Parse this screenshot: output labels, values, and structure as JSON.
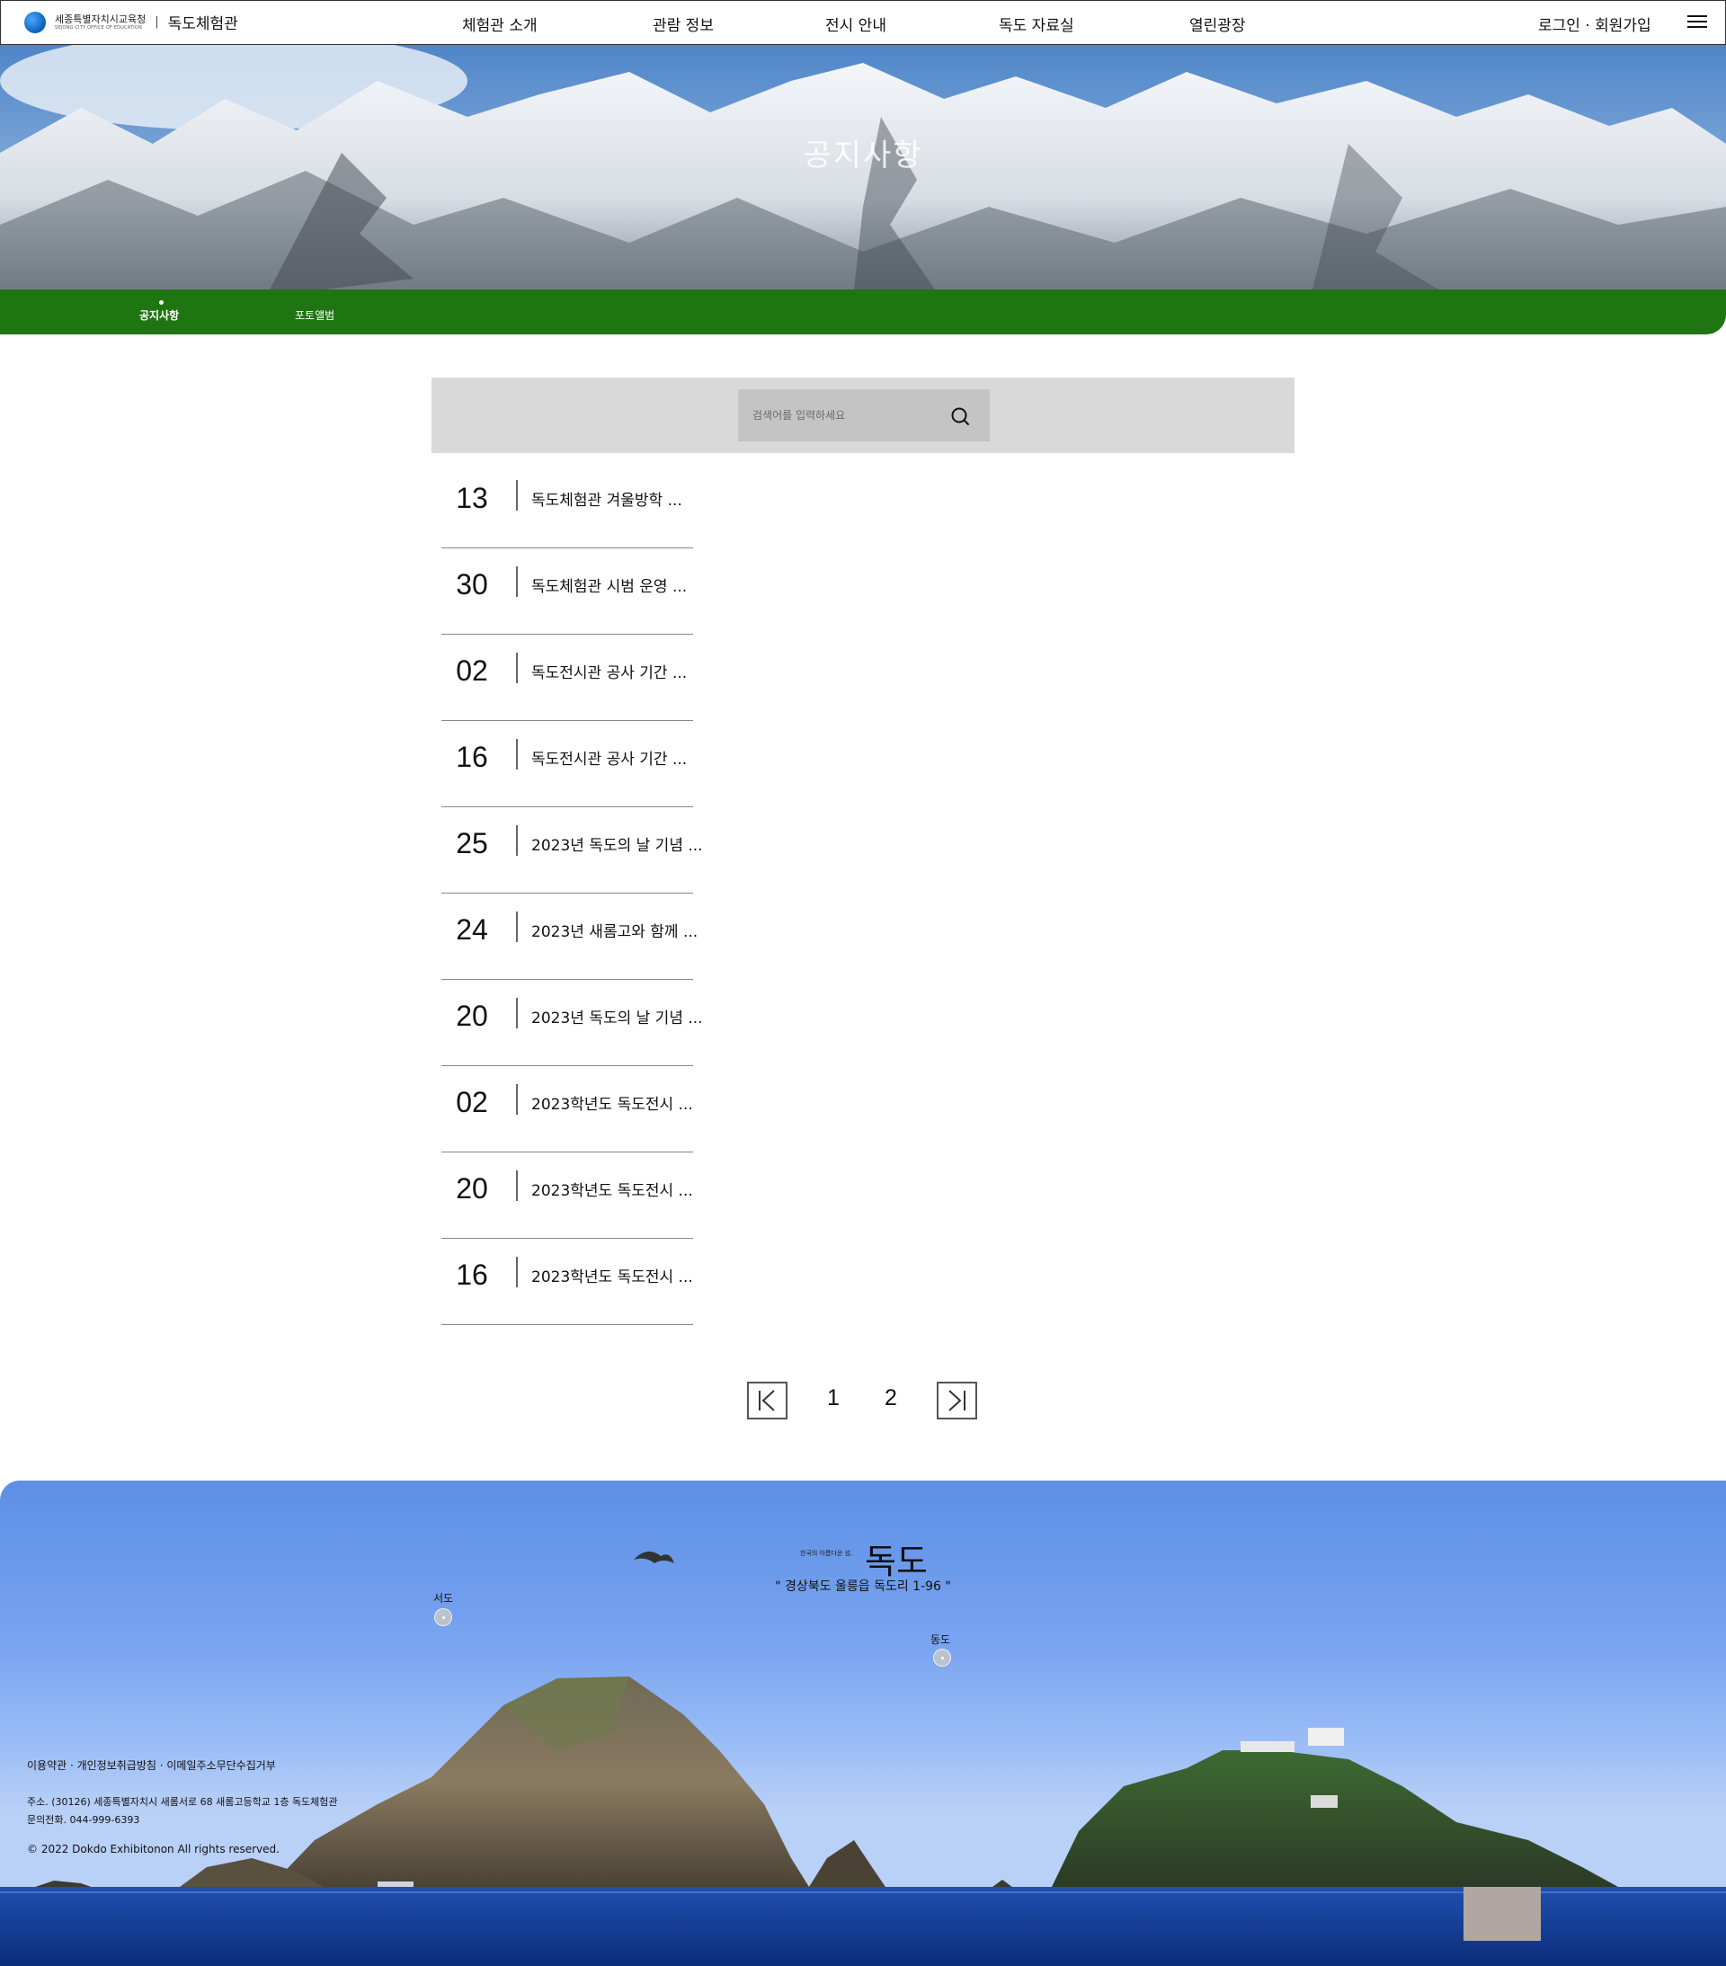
{
  "header": {
    "logo_ko": "세종특별자치시교육청",
    "logo_en": "SEJONG CITY OFFICE OF EDUCATION",
    "separator": "|",
    "site_name": "독도체험관",
    "nav": [
      "체험관 소개",
      "관람 정보",
      "전시 안내",
      "독도 자료실",
      "열린광장"
    ],
    "auth": "로그인 · 회원가입",
    "menu_icon": "hamburger-icon"
  },
  "hero": {
    "title": "공지사항"
  },
  "subnav": {
    "items": [
      "공지사항",
      "포토앨범"
    ],
    "active": "공지사항"
  },
  "search": {
    "placeholder": "검색어를 입력하세요",
    "icon": "search-icon"
  },
  "notices": [
    {
      "day": "13",
      "title": "독도체험관 겨울방학 ..."
    },
    {
      "day": "30",
      "title": "독도체험관 시범 운영 ..."
    },
    {
      "day": "02",
      "title": "독도전시관 공사 기간 ..."
    },
    {
      "day": "16",
      "title": "독도전시관 공사 기간 ..."
    },
    {
      "day": "25",
      "title": "2023년 독도의 날 기념 ..."
    },
    {
      "day": "24",
      "title": "2023년 새롬고와 함께 ..."
    },
    {
      "day": "20",
      "title": "2023년 독도의 날 기념 ..."
    },
    {
      "day": "02",
      "title": "2023학년도 독도전시 ..."
    },
    {
      "day": "20",
      "title": "2023학년도 독도전시 ..."
    },
    {
      "day": "16",
      "title": "2023학년도 독도전시 ..."
    }
  ],
  "pagination": {
    "pages": [
      "1",
      "2"
    ],
    "first_icon": "first-page-icon",
    "last_icon": "last-page-icon"
  },
  "footer": {
    "subtitle": "한국의 아름다운 섬,",
    "title": "독도",
    "address_quote": "\" 경상북도 울릉읍 독도리 1-96 \"",
    "markers": [
      "서도",
      "동도"
    ],
    "links": "이용약관 · 개인정보취급방침 · 이메일주소무단수집거부",
    "address": "주소. (30126) 세종특별자치시 새롬서로 68 새롬고등학교 1층 독도체험관",
    "phone": "문의전화. 044-999-6393",
    "copyright": "© 2022 Dokdo Exhibitonon All rights reserved."
  },
  "colors": {
    "subnav_bg": "#1f7512",
    "search_bg": "#d9d9d9",
    "footer_button": "#b0a7a2"
  }
}
